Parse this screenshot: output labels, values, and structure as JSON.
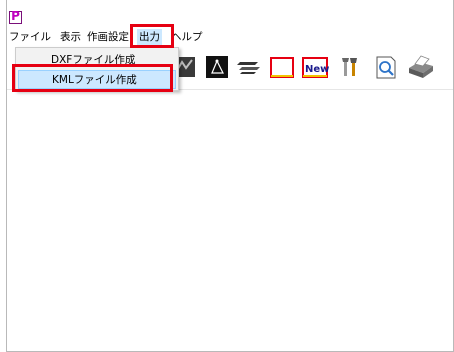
{
  "window": {
    "app_icon_glyph": "P",
    "app_icon_color": "#c000c0"
  },
  "menubar": {
    "items": [
      {
        "label": "ファイル"
      },
      {
        "label": "表示"
      },
      {
        "label": "作画設定"
      },
      {
        "label": "出力",
        "active": true
      },
      {
        "label": "ヘルプ"
      }
    ]
  },
  "output_menu": {
    "items": [
      {
        "label": "DXFファイル作成"
      },
      {
        "label": "KMLファイル作成",
        "hovered": true
      }
    ]
  },
  "toolbar": {
    "icons": [
      "map-icon",
      "triangle-draw-icon",
      "layer-stack-icon",
      "blank-page-icon",
      "new-page-icon",
      "tools-icon",
      "print-preview-icon",
      "print-icon"
    ],
    "new_label": "New"
  },
  "colors": {
    "highlight": "#e60012",
    "menu_active": "#cce8ff"
  }
}
